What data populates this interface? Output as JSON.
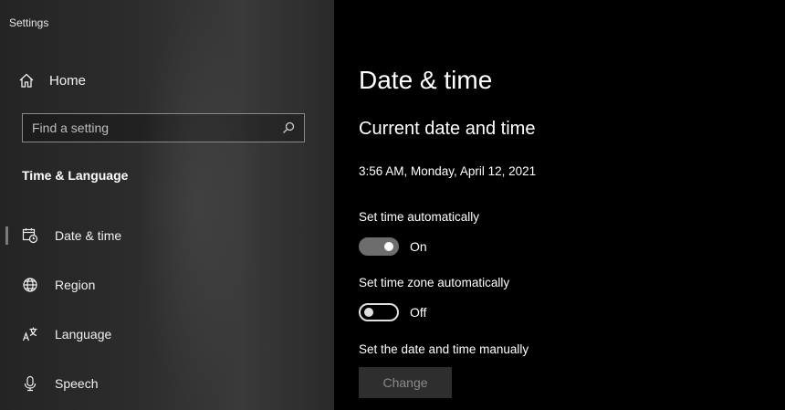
{
  "window": {
    "title": "Settings"
  },
  "sidebar": {
    "home_label": "Home",
    "search_placeholder": "Find a setting",
    "section_title": "Time & Language",
    "items": [
      {
        "label": "Date & time",
        "icon": "date-time-icon",
        "selected": true
      },
      {
        "label": "Region",
        "icon": "globe-icon",
        "selected": false
      },
      {
        "label": "Language",
        "icon": "language-icon",
        "selected": false
      },
      {
        "label": "Speech",
        "icon": "microphone-icon",
        "selected": false
      }
    ]
  },
  "main": {
    "page_title": "Date & time",
    "section_title": "Current date and time",
    "current_datetime": "3:56 AM, Monday, April 12, 2021",
    "auto_time": {
      "label": "Set time automatically",
      "state_text": "On",
      "on": true
    },
    "auto_timezone": {
      "label": "Set time zone automatically",
      "state_text": "Off",
      "on": false
    },
    "manual": {
      "label": "Set the date and time manually",
      "button_label": "Change",
      "enabled": false
    }
  },
  "colors": {
    "background": "#000000",
    "sidebar_background": "#2c2c2c",
    "toggle_on_track": "#6d6d6d",
    "disabled_button": "#2e2e2e",
    "text": "#ffffff"
  }
}
